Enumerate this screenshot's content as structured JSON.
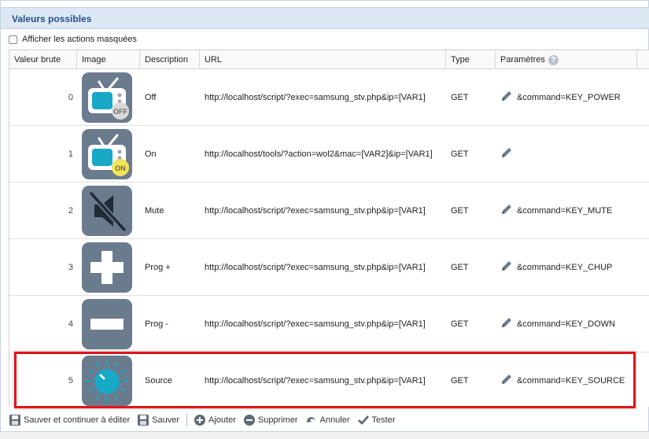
{
  "panel": {
    "title": "Valeurs possibles"
  },
  "hidden_actions": {
    "label": "Afficher les actions masquées",
    "checked": false
  },
  "columns": {
    "value": "Valeur brute",
    "image": "Image",
    "description": "Description",
    "url": "URL",
    "type": "Type",
    "params": "Paramètres"
  },
  "rows": [
    {
      "value": "0",
      "icon": "tv-off-icon",
      "description": "Off",
      "url": "http://localhost/script/?exec=samsung_stv.php&ip=[VAR1]",
      "type": "GET",
      "params": "&command=KEY_POWER"
    },
    {
      "value": "1",
      "icon": "tv-on-icon",
      "description": "On",
      "url": "http://localhost/tools/?action=wol2&mac=[VAR2]&ip=[VAR1]",
      "type": "GET",
      "params": ""
    },
    {
      "value": "2",
      "icon": "mute-icon",
      "description": "Mute",
      "url": "http://localhost/script/?exec=samsung_stv.php&ip=[VAR1]",
      "type": "GET",
      "params": "&command=KEY_MUTE"
    },
    {
      "value": "3",
      "icon": "plus-icon",
      "description": "Prog +",
      "url": "http://localhost/script/?exec=samsung_stv.php&ip=[VAR1]",
      "type": "GET",
      "params": "&command=KEY_CHUP"
    },
    {
      "value": "4",
      "icon": "minus-icon",
      "description": "Prog -",
      "url": "http://localhost/script/?exec=samsung_stv.php&ip=[VAR1]",
      "type": "GET",
      "params": "&command=KEY_DOWN"
    },
    {
      "value": "5",
      "icon": "source-knob-icon",
      "description": "Source",
      "url": "http://localhost/script/?exec=samsung_stv.php&ip=[VAR1]",
      "type": "GET",
      "params": "&command=KEY_SOURCE"
    }
  ],
  "tv_badges": {
    "off": "OFF",
    "on": "ON"
  },
  "help_glyph": "?",
  "toolbar": {
    "save_continue": "Sauver et continuer à éditer",
    "save": "Sauver",
    "add": "Ajouter",
    "delete": "Supprimer",
    "cancel": "Annuler",
    "test": "Tester"
  },
  "colors": {
    "tile_bg": "#6b7b8e",
    "accent_teal": "#17a9c6",
    "badge_yellow": "#f1e35a",
    "highlight_red": "#e0161a",
    "title_blue": "#1f4f86"
  }
}
